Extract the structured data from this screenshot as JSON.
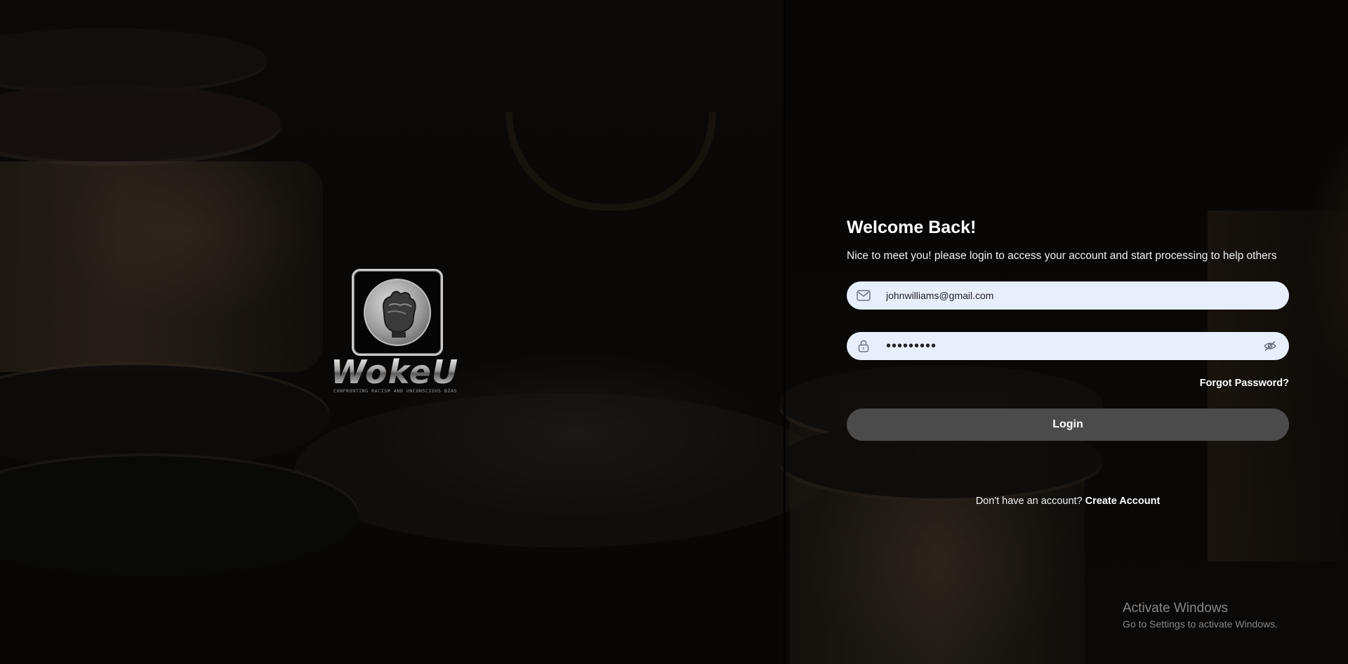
{
  "brand": {
    "name": "WokeU",
    "tagline": "CONFRONTING RACISM AND UNCONSCIOUS BIAS"
  },
  "login": {
    "title": "Welcome Back!",
    "subtitle": "Nice to meet you! please login to access your account and start processing to help others",
    "email": {
      "value": "johnwilliams@gmail.com",
      "icon": "mail-icon"
    },
    "password": {
      "value": "•••••••••",
      "icon": "lock-icon",
      "toggle_icon": "eye-off-icon"
    },
    "forgot_label": "Forgot Password?",
    "submit_label": "Login",
    "signup_prompt": "Don't have an account?",
    "signup_link": "Create Account"
  },
  "watermark": {
    "title": "Activate Windows",
    "subtitle": "Go to Settings to activate Windows."
  },
  "colors": {
    "field_bg": "#e8effc",
    "button_bg": "#4b4b4b",
    "page_bg": "#060504"
  }
}
